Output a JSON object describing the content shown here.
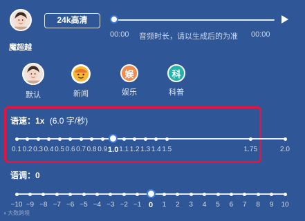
{
  "speaker": {
    "name": "魔超越"
  },
  "quality_badge": "24k高清",
  "player": {
    "progress": 0,
    "time_start": "00:00",
    "note": "音频时长，请以生成后的为准",
    "time_end": "00:00"
  },
  "voices": [
    {
      "label": "默认",
      "icon": "avatar"
    },
    {
      "label": "新闻",
      "icon": "news-face-icon",
      "color": "#f5a623"
    },
    {
      "label": "娱乐",
      "icon_text": "娱",
      "color": "#f08c4f"
    },
    {
      "label": "科普",
      "icon_text": "科",
      "color": "#23b3a8"
    }
  ],
  "speed": {
    "label": "语速：",
    "value": "1x",
    "detail": "(6.0 字/秒)",
    "selected": "1.0",
    "ticks": [
      "0.1",
      "0.2",
      "0.3",
      "0.4",
      "0.5",
      "0.6",
      "0.7",
      "0.8",
      "0.9",
      "1.0",
      "1.1",
      "1.2",
      "1.3",
      "1.4",
      "1.5",
      "1.75",
      "2.0"
    ]
  },
  "pitch": {
    "label": "语调：",
    "value": "0",
    "selected": "0",
    "ticks": [
      "-10",
      "-9",
      "-8",
      "-7",
      "-6",
      "-5",
      "-4",
      "-3",
      "-2",
      "-1",
      "0",
      "1",
      "2",
      "3",
      "4",
      "5",
      "6",
      "7",
      "8",
      "9",
      "10"
    ]
  },
  "watermark": "大数跨境",
  "colors": {
    "background": "#2f5696",
    "highlight_box": "#e8123c",
    "accent": "#3d7be0"
  }
}
